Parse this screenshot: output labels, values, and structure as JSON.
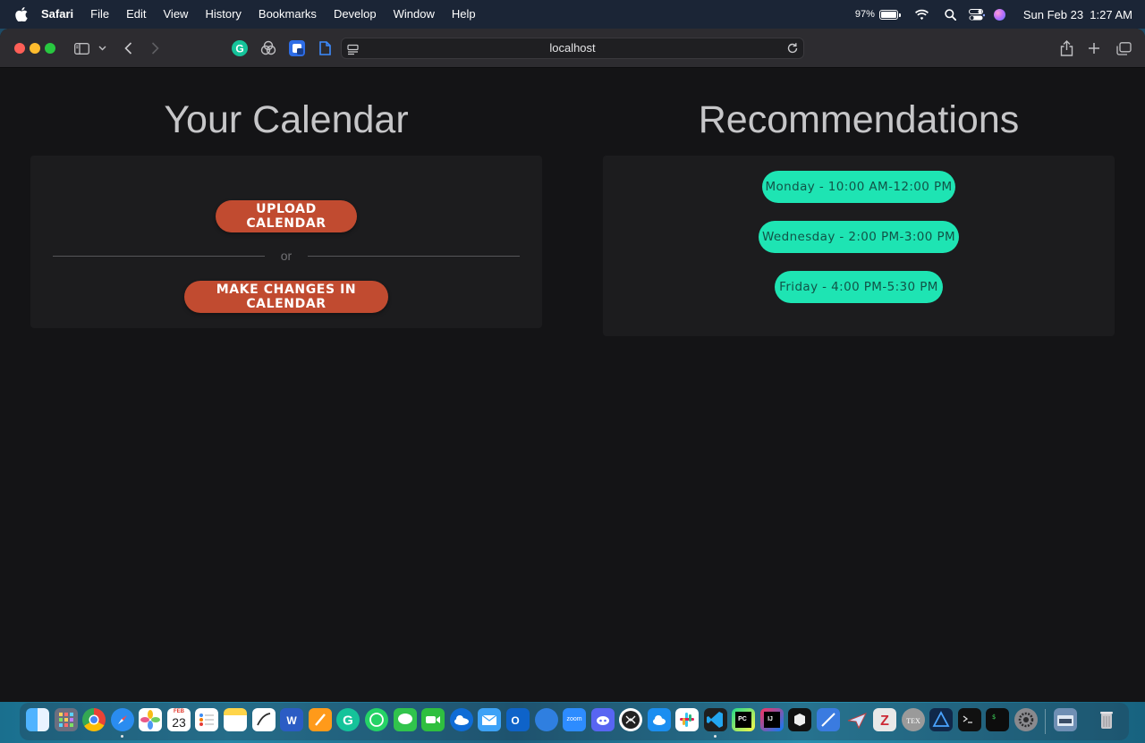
{
  "menubar": {
    "app_name": "Safari",
    "items": [
      "File",
      "Edit",
      "View",
      "History",
      "Bookmarks",
      "Develop",
      "Window",
      "Help"
    ],
    "battery_percent": "97%",
    "datetime": "Sun Feb 23  1:27 AM"
  },
  "browser": {
    "url": "localhost"
  },
  "calendar_section": {
    "title": "Your Calendar",
    "upload_button": "UPLOAD CALENDAR",
    "divider_text": "or",
    "edit_button": "MAKE CHANGES IN CALENDAR"
  },
  "recommendations_section": {
    "title": "Recommendations",
    "slots": [
      "Monday - 10:00 AM-12:00 PM",
      "Wednesday - 2:00 PM-3:00 PM",
      "Friday - 4:00 PM-5:30 PM"
    ]
  },
  "dock": {
    "calendar_month": "FEB",
    "calendar_day": "23",
    "zoom_label": "zoom"
  },
  "colors": {
    "accent_orange": "#c14b30",
    "accent_teal": "#1ee4b3",
    "page_background": "#141416",
    "card_background": "#1c1c1e"
  }
}
